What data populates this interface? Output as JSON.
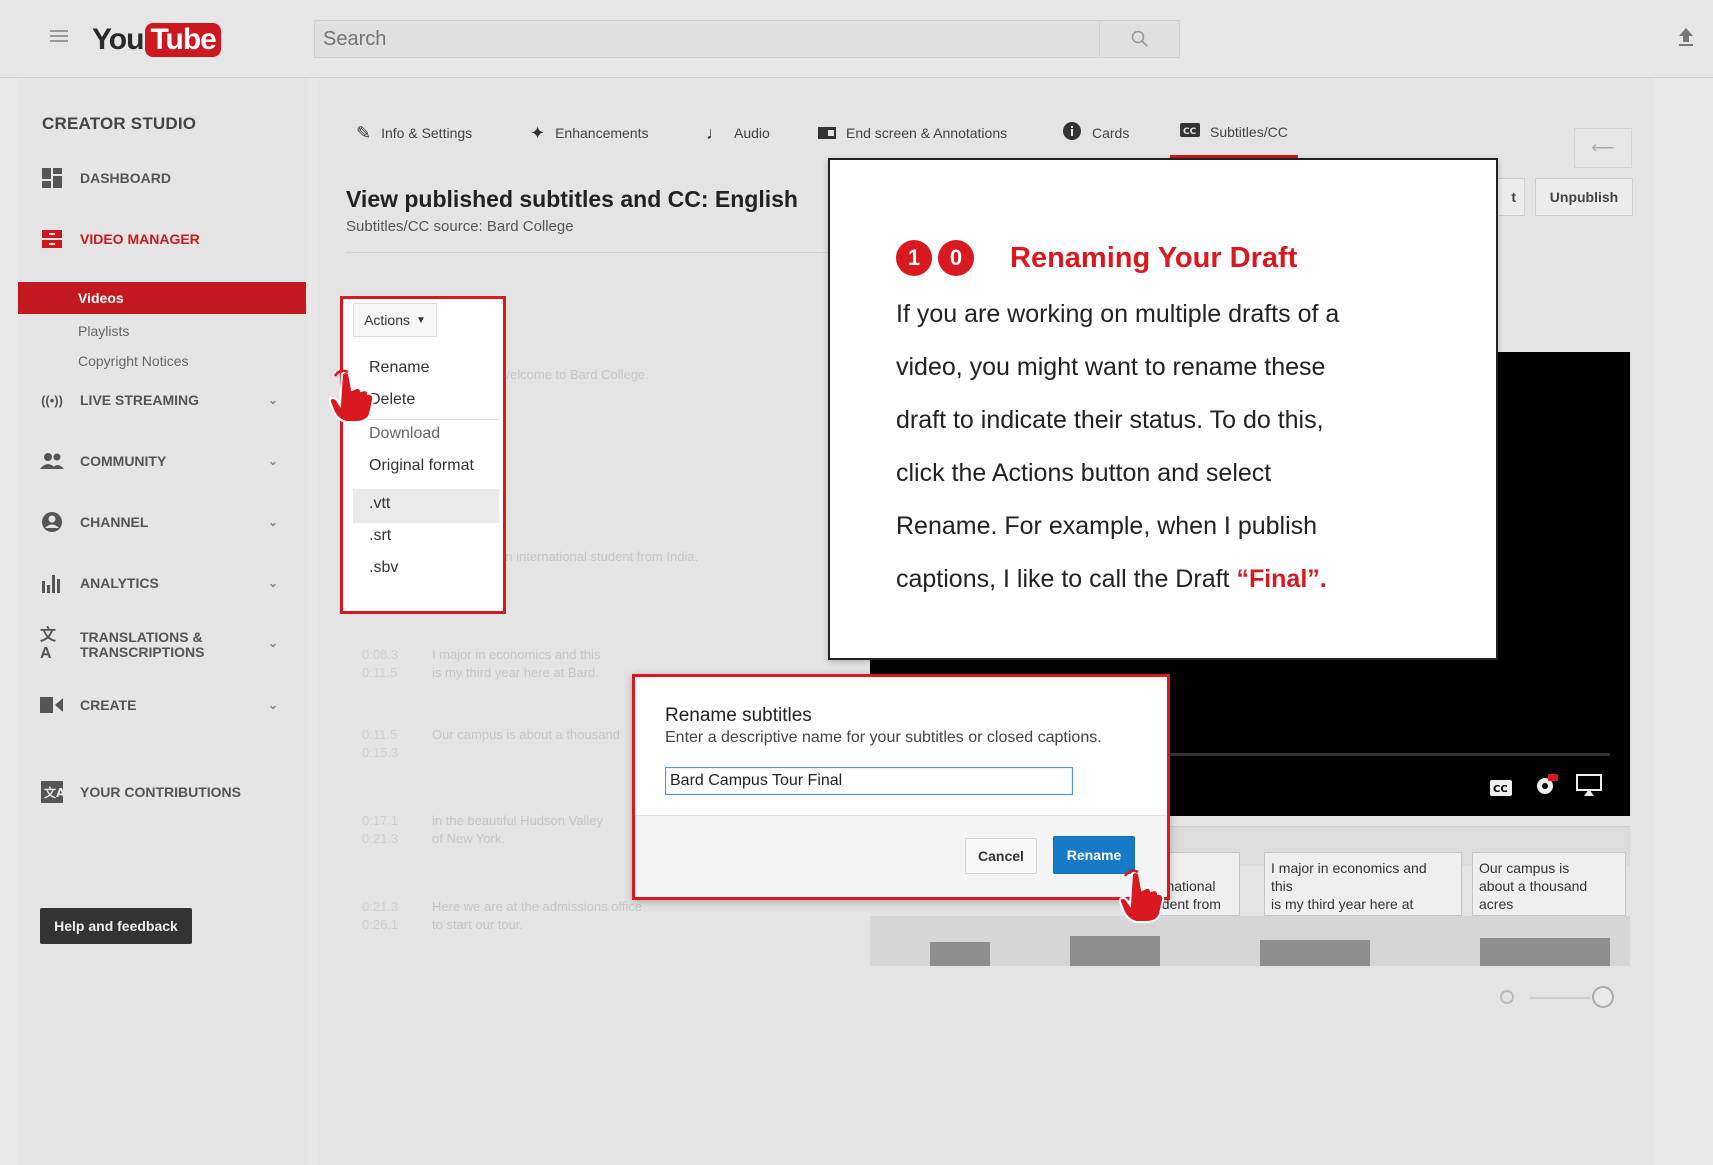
{
  "header": {
    "logo_you": "You",
    "logo_tube": "Tube",
    "search_placeholder": "Search"
  },
  "sidebar": {
    "title": "CREATOR STUDIO",
    "items": [
      {
        "label": "DASHBOARD",
        "icon": "dashboard-icon"
      },
      {
        "label": "VIDEO MANAGER",
        "icon": "video-manager-icon"
      },
      {
        "label": "LIVE STREAMING",
        "icon": "live-streaming-icon"
      },
      {
        "label": "COMMUNITY",
        "icon": "community-icon"
      },
      {
        "label": "CHANNEL",
        "icon": "channel-icon"
      },
      {
        "label": "ANALYTICS",
        "icon": "analytics-icon"
      },
      {
        "label": "TRANSLATIONS &",
        "label2": "TRANSCRIPTIONS",
        "icon": "translate-icon"
      },
      {
        "label": "CREATE",
        "icon": "create-icon"
      },
      {
        "label": "YOUR CONTRIBUTIONS",
        "icon": "contributions-icon"
      }
    ],
    "subitems": [
      "Videos",
      "Playlists",
      "Copyright Notices"
    ],
    "help_button": "Help and feedback"
  },
  "tabs": [
    {
      "label": "Info & Settings",
      "icon": "pencil-icon"
    },
    {
      "label": "Enhancements",
      "icon": "wand-icon"
    },
    {
      "label": "Audio",
      "icon": "music-note-icon"
    },
    {
      "label": "End screen & Annotations",
      "icon": "end-screen-icon"
    },
    {
      "label": "Cards",
      "icon": "info-icon"
    },
    {
      "label": "Subtitles/CC",
      "icon": "cc-icon"
    }
  ],
  "main": {
    "title": "View published subtitles and CC: English",
    "subtitle": "Subtitles/CC source: Bard College",
    "unpublish": "Unpublish",
    "hint_btn": "t"
  },
  "subtitle_rows": [
    {
      "tc": "",
      "text": "Welcome to Bard College."
    },
    {
      "tc": "",
      "text": ""
    },
    {
      "tc": "",
      "text": "an international student from India."
    },
    {
      "tc": "0:08.3\n0:11.5",
      "text": "I major in economics and this\nis my third year here at Bard."
    },
    {
      "tc": "0:11.5\n0:15.3",
      "text": "Our campus is about a thousand"
    },
    {
      "tc": "0:17.1\n0:21.3",
      "text": "in the beautiful Hudson Valley\nof New York."
    },
    {
      "tc": "0:21.3\n0:26.1",
      "text": "Here we are at the admissions office\nto start our tour."
    }
  ],
  "actions_menu": {
    "button": "Actions",
    "items": [
      "Rename",
      "Delete",
      "Download",
      "Original format",
      ".vtt",
      ".srt",
      ".sbv"
    ]
  },
  "callout": {
    "step_digits": [
      "1",
      "0"
    ],
    "title": "Renaming Your Draft",
    "lines": [
      "If you are working on multiple drafts of a",
      "video, you might want to rename these",
      "draft to indicate their status. To do this,",
      "click the Actions button and select",
      "Rename. For example, when I publish"
    ],
    "last_line": "captions, I like to call the Draft ",
    "final": "“Final”."
  },
  "dialog": {
    "title": "Rename subtitles",
    "description": "Enter a descriptive name for your subtitles or closed captions.",
    "input_value": "Bard Campus Tour Final",
    "cancel": "Cancel",
    "rename": "Rename"
  },
  "caption_boxes": [
    {
      "lines": [
        "an",
        "ernational",
        "udent from"
      ]
    },
    {
      "lines": [
        "I major in economics and",
        "this",
        "is my third year here at"
      ]
    },
    {
      "lines": [
        "Our campus is",
        "about a thousand",
        "acres"
      ]
    }
  ],
  "colors": {
    "accent_red": "#d9191f",
    "youtube_red": "#cc181e",
    "rename_blue": "#167ac6"
  }
}
